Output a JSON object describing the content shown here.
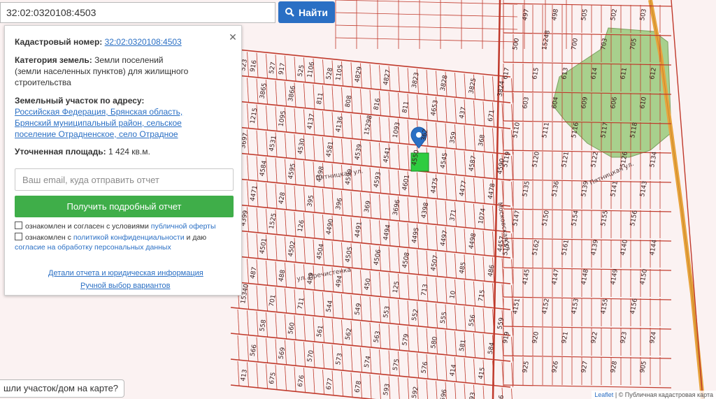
{
  "search": {
    "value": "32:02:0320108:4503",
    "button_label": "Найти"
  },
  "panel": {
    "cadastral_label": "Кадастровый номер:",
    "cadastral_value": "32:02:0320108:4503",
    "category_label": "Категория земель:",
    "category_value": "Земли поселений (земли населенных пунктов) для жилищного строительства",
    "address_label": "Земельный участок по адресу:",
    "address_value": "Российская Федерация, Брянская область, Брянский муниципальный район, сельское поселение Отрадненское, село Отрадное",
    "area_label": "Уточненная площадь:",
    "area_value": "1 424 кв.м.",
    "email_placeholder": "Ваш email, куда отправить отчет",
    "report_button": "Получить подробный отчет",
    "consent1_text": "ознакомлен и согласен с условиями",
    "consent1_link": "публичной оферты",
    "consent2_text": "ознакомлен с",
    "consent2_link": "политикой конфиденциальности",
    "consent2_tail": "и даю",
    "consent2_link2": "согласие на обработку персональных данных",
    "details_link": "Детали отчета и юридическая информация",
    "manual_link": "Ручной выбор вариантов"
  },
  "map": {
    "bottom_hint": "шли участок/дом на карте?",
    "attribution_leaflet": "Leaflet",
    "attribution_rest": "| © Публичная кадастровая карта",
    "streets": [
      "Пятницкая ул.",
      "ул. Пречистенка",
      "Московская ул.",
      "Пятницкая ул."
    ],
    "parcel_numbers": [
      "523",
      "527",
      "525",
      "528",
      "4829",
      "4827",
      "3823",
      "3828",
      "3825",
      "3824",
      "3865",
      "3866",
      "811",
      "808",
      "816",
      "811",
      "4653",
      "437",
      "671",
      "1215",
      "1095",
      "4137",
      "4136",
      "15298",
      "1093",
      "362",
      "359",
      "368",
      "3697",
      "4531",
      "4530",
      "4581",
      "4539",
      "4541",
      "4550",
      "4545",
      "4587",
      "4590",
      "4584",
      "4595",
      "4598",
      "4599",
      "4593",
      "4601",
      "4475",
      "4477",
      "4478",
      "4471",
      "428",
      "395",
      "396",
      "369",
      "3696",
      "4398",
      "371",
      "1074",
      "4399",
      "1525",
      "126",
      "4490",
      "4491",
      "4494",
      "4495",
      "4497",
      "4498",
      "4457",
      "4501",
      "4502",
      "4504",
      "4505",
      "4506",
      "4508",
      "4507",
      "485",
      "486",
      "487",
      "488",
      "489",
      "494",
      "450",
      "125",
      "713",
      "10",
      "715",
      "15340",
      "701",
      "711",
      "544",
      "549",
      "553",
      "552",
      "555",
      "556",
      "559",
      "558",
      "560",
      "561",
      "562",
      "563",
      "579",
      "580",
      "581",
      "584",
      "566",
      "569",
      "570",
      "573",
      "574",
      "575",
      "576",
      "414",
      "415",
      "413",
      "675",
      "676",
      "677",
      "678",
      "593",
      "592",
      "596",
      "493",
      "496",
      "497",
      "498",
      "505",
      "502",
      "503",
      "500",
      "15248",
      "700",
      "703",
      "705",
      "617",
      "615",
      "613",
      "614",
      "611",
      "612",
      "603",
      "604",
      "609",
      "606",
      "610",
      "5110",
      "5111",
      "5116",
      "5117",
      "5118",
      "5119",
      "5120",
      "5121",
      "5122",
      "5126",
      "5134",
      "5135",
      "5136",
      "5139",
      "5141",
      "5143",
      "5147",
      "5150",
      "5154",
      "5155",
      "5156",
      "5157",
      "5162",
      "5161",
      "4139",
      "4140",
      "4144",
      "4145",
      "4147",
      "4148",
      "4149",
      "4150",
      "4151",
      "4152",
      "4153",
      "4155",
      "4156",
      "919",
      "920",
      "921",
      "922",
      "923",
      "924",
      "925",
      "926",
      "927",
      "928",
      "905",
      "916",
      "917",
      "1106",
      "1105"
    ]
  },
  "colors": {
    "parcel_line": "#c0392b",
    "selected_parcel": "#2ecc40",
    "road": "#e8a33d",
    "green_area": "#a8d08d",
    "find_button": "#2a6fc4",
    "report_button": "#3fae49",
    "link": "#2a6fc4"
  },
  "icons": {
    "search": "magnifier-icon",
    "close": "close-icon",
    "marker": "map-pin-icon"
  }
}
